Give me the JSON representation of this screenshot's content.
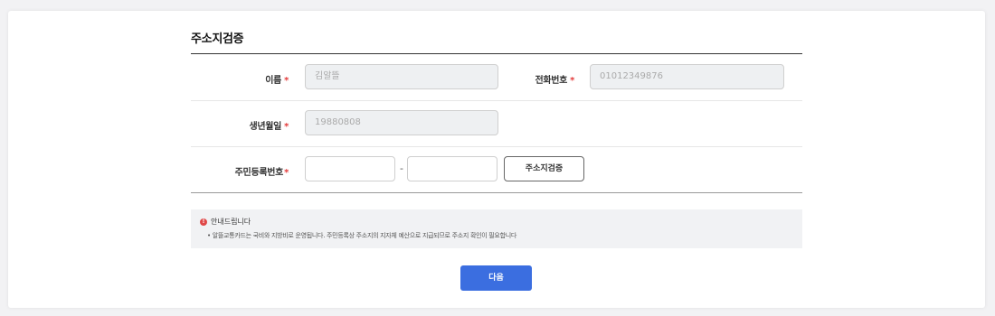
{
  "form": {
    "title": "주소지검증",
    "required_mark": "*",
    "fields": {
      "name": {
        "label": "이름",
        "value": "김알뜰"
      },
      "phone": {
        "label": "전화번호",
        "value": "01012349876"
      },
      "birthdate": {
        "label": "생년월일",
        "value": "19880808"
      },
      "resident_number": {
        "label": "주민등록번호",
        "front_value": "",
        "back_value": "",
        "separator": "-"
      }
    },
    "verify_button_label": "주소지검증"
  },
  "notice": {
    "heading": "안내드립니다",
    "body": "• 알뜰교통카드는 국비와 지방비로 운영됩니다. 주민등록상 주소지의 지자체 예산으로 지급되므로 주소지 확인이 필요합니다",
    "icon": "info-icon",
    "icon_color": "#e04848"
  },
  "next_button_label": "다음",
  "colors": {
    "accent": "#3b6ee0",
    "required": "#e33a3a"
  }
}
